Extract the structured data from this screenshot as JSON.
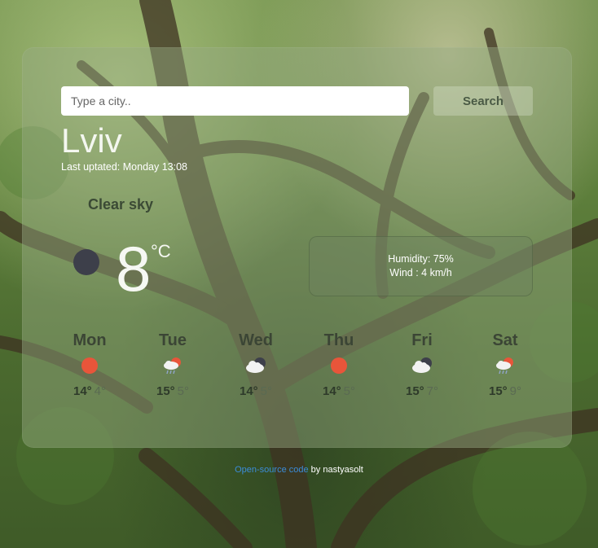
{
  "search": {
    "placeholder": "Type a city..",
    "button_label": "Search"
  },
  "current": {
    "city": "Lviv",
    "updated": "Last uptated: Monday 13:08",
    "description": "Clear sky",
    "icon": "moon-icon",
    "temperature": "8",
    "unit": "°C",
    "humidity": "Humidity: 75%",
    "wind": "Wind : 4 km/h"
  },
  "forecast": [
    {
      "day": "Mon",
      "icon": "sun-icon",
      "max": "14°",
      "min": "4°"
    },
    {
      "day": "Tue",
      "icon": "rain-sun-icon",
      "max": "15°",
      "min": "5°"
    },
    {
      "day": "Wed",
      "icon": "cloud-moon-icon",
      "max": "14°",
      "min": "5°"
    },
    {
      "day": "Thu",
      "icon": "sun-icon",
      "max": "14°",
      "min": "5°"
    },
    {
      "day": "Fri",
      "icon": "cloud-moon-icon",
      "max": "15°",
      "min": "7°"
    },
    {
      "day": "Sat",
      "icon": "rain-sun-icon",
      "max": "15°",
      "min": "9°"
    }
  ],
  "footer": {
    "link_text": "Open-source code",
    "suffix": " by nastyasolt"
  },
  "colors": {
    "sun": "#e8553a",
    "moon": "#3d3f4a",
    "link": "#3b8cd8"
  }
}
